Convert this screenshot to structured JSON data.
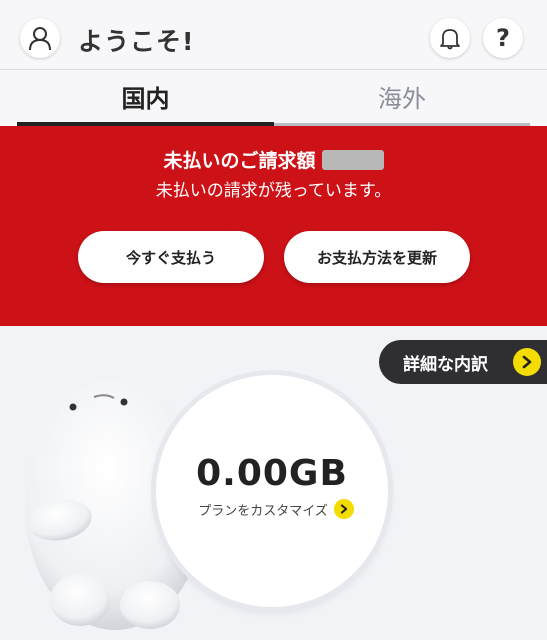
{
  "header": {
    "welcome": "ようこそ!",
    "help_label": "?"
  },
  "tabs": [
    {
      "label": "国内",
      "active": true
    },
    {
      "label": "海外",
      "active": false
    }
  ],
  "banner": {
    "title": "未払いのご請求額",
    "subtitle": "未払いの請求が残っています。",
    "pay_now": "今すぐ支払う",
    "update_method": "お支払方法を更新",
    "color": "#cc1117"
  },
  "details_button": "詳細な内訳",
  "usage": {
    "value": "0.00GB",
    "customize_link": "プランをカスタマイズ"
  },
  "icons": [
    "user-icon",
    "bell-icon",
    "help-icon",
    "chevron-right-icon"
  ],
  "accent_color": "#f5dc00"
}
